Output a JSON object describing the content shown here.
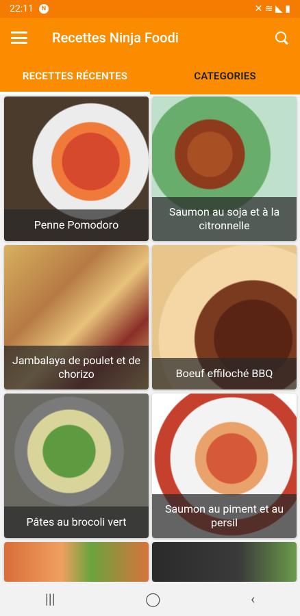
{
  "status": {
    "time": "22:11",
    "notif": "N",
    "right": "✕ ≋ ◣ ▮"
  },
  "appbar": {
    "title": "Recettes Ninja Foodi"
  },
  "tabs": [
    {
      "label": "RECETTES RÉCENTES"
    },
    {
      "label": "CATEGORIES"
    }
  ],
  "recipes": [
    {
      "title": "Penne Pomodoro"
    },
    {
      "title": "Saumon au soja et à la citronnelle"
    },
    {
      "title": "Jambalaya de poulet et de chorizo"
    },
    {
      "title": "Boeuf effiloché BBQ"
    },
    {
      "title": "Pâtes au brocoli vert"
    },
    {
      "title": "Saumon au piment et au persil"
    }
  ],
  "navbar": {
    "recent": "|||",
    "home": "◯",
    "back": "‹"
  }
}
